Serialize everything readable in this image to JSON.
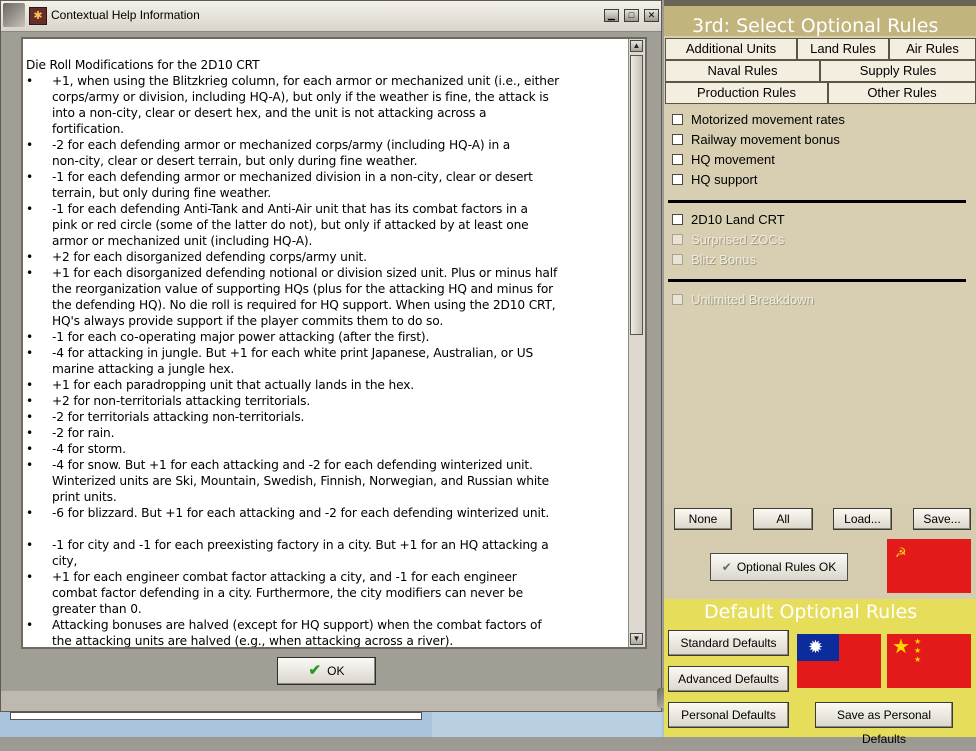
{
  "help_window": {
    "title": "Contextual Help Information",
    "heading": "Die Roll Modifications for the 2D10 CRT",
    "bullet_glyph": "•",
    "bullets": [
      [
        "+1, when using the Blitzkrieg column, for each armor or mechanized unit (i.e., either",
        "corps/army or division, including HQ-A), but only if the weather is fine, the attack is",
        "into a non-city, clear or desert hex, and the unit is not attacking across a",
        "fortification."
      ],
      [
        "-2 for each defending armor or mechanized corps/army (including HQ-A) in a",
        "non-city, clear or desert terrain, but only during fine weather."
      ],
      [
        "-1 for each defending armor or mechanized division in a non-city, clear or desert",
        "terrain, but only during fine weather."
      ],
      [
        "-1 for each defending Anti-Tank and Anti-Air unit that has its combat factors in a",
        "pink or red circle (some of the latter do not), but only if attacked by at least one",
        "armor or mechanized unit (including HQ-A)."
      ],
      [
        "+2 for each disorganized defending corps/army unit."
      ],
      [
        "+1 for each disorganized defending notional or division sized unit.  Plus or minus half",
        "the reorganization value of supporting HQs (plus for the attacking HQ and minus for",
        "the defending HQ).  No die roll is required for HQ support.  When using the 2D10 CRT,",
        "HQ's always provide support if the player commits them to do so."
      ],
      [
        "-1 for each co-operating major power attacking (after the first)."
      ],
      [
        "-4 for attacking in jungle.  But +1 for each white print Japanese, Australian, or US",
        "marine attacking a jungle hex."
      ],
      [
        "+1 for each paradropping unit that actually lands in the hex."
      ],
      [
        "+2 for non-territorials attacking territorials."
      ],
      [
        "-2 for territorials attacking non-territorials."
      ],
      [
        "-2 for rain."
      ],
      [
        "-4 for storm."
      ],
      [
        "-4 for snow.  But +1 for each attacking and -2 for each defending winterized unit.",
        "Winterized units are Ski, Mountain, Swedish, Finnish, Norwegian, and Russian white",
        "print units."
      ],
      [
        "-6 for blizzard.  But +1 for each attacking and -2 for each defending winterized unit."
      ],
      [],
      [
        "-1 for city and -1 for each preexisting factory in a city.  But +1 for an HQ attacking a",
        "city,"
      ],
      [
        "+1 for each engineer combat factor attacking a city, and -1 for each engineer",
        "combat factor defending in a city.  Furthermore, the city modifiers can never be",
        "greater than 0."
      ],
      [
        "Attacking bonuses are halved (except for HQ support) when the combat factors of",
        "the attacking units are halved (e.g., when attacking across a river)."
      ]
    ],
    "ok_label": "OK"
  },
  "rules_panel": {
    "title": "3rd: Select Optional Rules",
    "tabs": [
      {
        "label": "Additional Units",
        "active": false
      },
      {
        "label": "Land Rules",
        "active": true
      },
      {
        "label": "Air Rules",
        "active": false
      },
      {
        "label": "Naval Rules",
        "active": false
      },
      {
        "label": "Supply Rules",
        "active": false
      },
      {
        "label": "Production Rules",
        "active": false
      },
      {
        "label": "Other Rules",
        "active": false
      }
    ],
    "rules": [
      {
        "label": "Motorized movement rates",
        "enabled": true
      },
      {
        "label": "Railway movement bonus",
        "enabled": true
      },
      {
        "label": "HQ movement",
        "enabled": true
      },
      {
        "label": "HQ support",
        "enabled": true
      },
      {
        "label": "2D10 Land CRT",
        "enabled": true
      },
      {
        "label": "Surprised ZOCs",
        "enabled": false
      },
      {
        "label": "Blitz Bonus",
        "enabled": false
      },
      {
        "label": "Unlimited Breakdown",
        "enabled": false
      }
    ],
    "buttons": {
      "none": "None",
      "all": "All",
      "load": "Load...",
      "save": "Save..."
    },
    "optional_ok_label": "Optional Rules OK",
    "default_title": "Default Optional Rules",
    "default_buttons": {
      "standard": "Standard Defaults",
      "advanced": "Advanced Defaults",
      "personal": "Personal Defaults",
      "save_personal": "Save as Personal Defaults"
    },
    "colors": {
      "active_tab": "#ffff00",
      "title_bar": "#c2b47d",
      "default_section": "#e6dd5b",
      "flag_red": "#e41a1a"
    }
  }
}
